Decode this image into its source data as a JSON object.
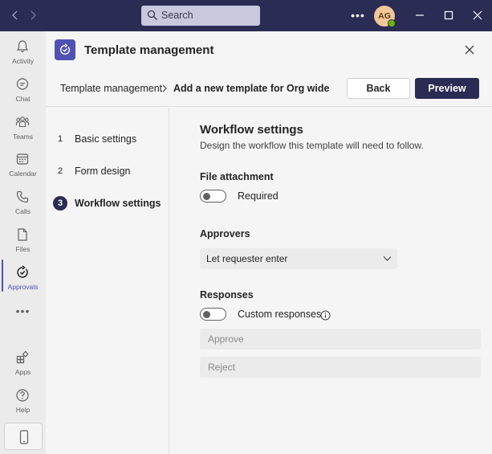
{
  "titlebar": {
    "search_label": "Search",
    "avatar_initials": "AG",
    "presence_color": "#6bb700",
    "background_color": "#2b2c54"
  },
  "rail": {
    "items": [
      {
        "label": "Activity",
        "icon": "bell-icon"
      },
      {
        "label": "Chat",
        "icon": "chat-icon"
      },
      {
        "label": "Teams",
        "icon": "teams-icon"
      },
      {
        "label": "Calendar",
        "icon": "calendar-icon"
      },
      {
        "label": "Calls",
        "icon": "phone-icon"
      },
      {
        "label": "Files",
        "icon": "file-icon"
      },
      {
        "label": "Approvals",
        "icon": "approvals-icon",
        "active": true
      }
    ],
    "more": "•••",
    "bottom_items": [
      {
        "label": "Apps",
        "icon": "apps-icon"
      },
      {
        "label": "Help",
        "icon": "help-icon"
      }
    ],
    "accent_color": "#4f52b2"
  },
  "header": {
    "title": "Template management"
  },
  "breadcrumb": {
    "parent": "Template management",
    "current": "Add a new template for Org wide"
  },
  "actions": {
    "back_label": "Back",
    "preview_label": "Preview"
  },
  "steps": [
    {
      "number": "1",
      "label": "Basic settings",
      "active": false
    },
    {
      "number": "2",
      "label": "Form design",
      "active": false
    },
    {
      "number": "3",
      "label": "Workflow settings",
      "active": true
    }
  ],
  "workflow": {
    "title": "Workflow settings",
    "description": "Design the workflow this template will need to follow.",
    "file_attachment": {
      "heading": "File attachment",
      "toggle_label": "Required",
      "enabled": false
    },
    "approvers": {
      "heading": "Approvers",
      "selected": "Let requester enter"
    },
    "responses": {
      "heading": "Responses",
      "toggle_label": "Custom responses",
      "enabled": false,
      "option1_placeholder": "Approve",
      "option2_placeholder": "Reject"
    }
  }
}
